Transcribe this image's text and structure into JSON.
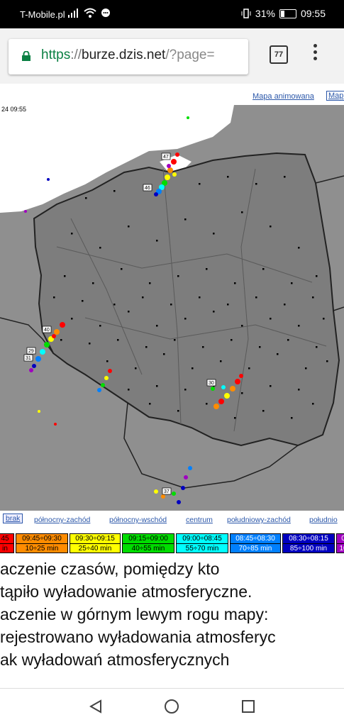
{
  "status_bar": {
    "carrier": "T-Mobile.pl",
    "battery": "31%",
    "time": "09:55"
  },
  "browser": {
    "url_scheme": "https",
    "url_separator": "://",
    "url_host": "burze.dzis.net",
    "url_path": "/?page=",
    "tab_count": "77"
  },
  "page": {
    "top_links": [
      "Mapa animowana",
      "Map"
    ],
    "timestamp": "24 09:55",
    "region_links": [
      "brak",
      "północny-zachód",
      "północny-wschód",
      "centrum",
      "południowy-zachód",
      "południo"
    ],
    "legend": [
      {
        "time": "45",
        "minutes": "in",
        "color": "#ff0000"
      },
      {
        "time": "09:45÷09:30",
        "minutes": "10÷25 min",
        "color": "#ff8c00"
      },
      {
        "time": "09:30÷09:15",
        "minutes": "25÷40 min",
        "color": "#ffff00"
      },
      {
        "time": "09:15÷09:00",
        "minutes": "40÷55 min",
        "color": "#00dd00"
      },
      {
        "time": "09:00÷08:45",
        "minutes": "55÷70 min",
        "color": "#00ffff"
      },
      {
        "time": "08:45÷08:30",
        "minutes": "70÷85 min",
        "color": "#0080ff"
      },
      {
        "time": "08:30÷08:15",
        "minutes": "85÷100 min",
        "color": "#0000c0"
      },
      {
        "time": "0",
        "minutes": "10",
        "color": "#a000c0"
      }
    ],
    "description_lines": [
      "aczenie     czasów,     pomiędzy     kto",
      "tąpiło wyładowanie atmosferyczne.",
      "aczenie w górnym lewym rogu mapy:",
      "rejestrowano wyładowania atmosferyc",
      "ak wyładowań atmosferycznych"
    ]
  },
  "map": {
    "storm_labels": [
      "47",
      "46",
      "40",
      "29",
      "31",
      "30",
      "37"
    ],
    "colors": {
      "land": "#8f8f8f",
      "poland": "#7d7d7d",
      "sea": "#ffffff",
      "border": "#222222"
    }
  }
}
